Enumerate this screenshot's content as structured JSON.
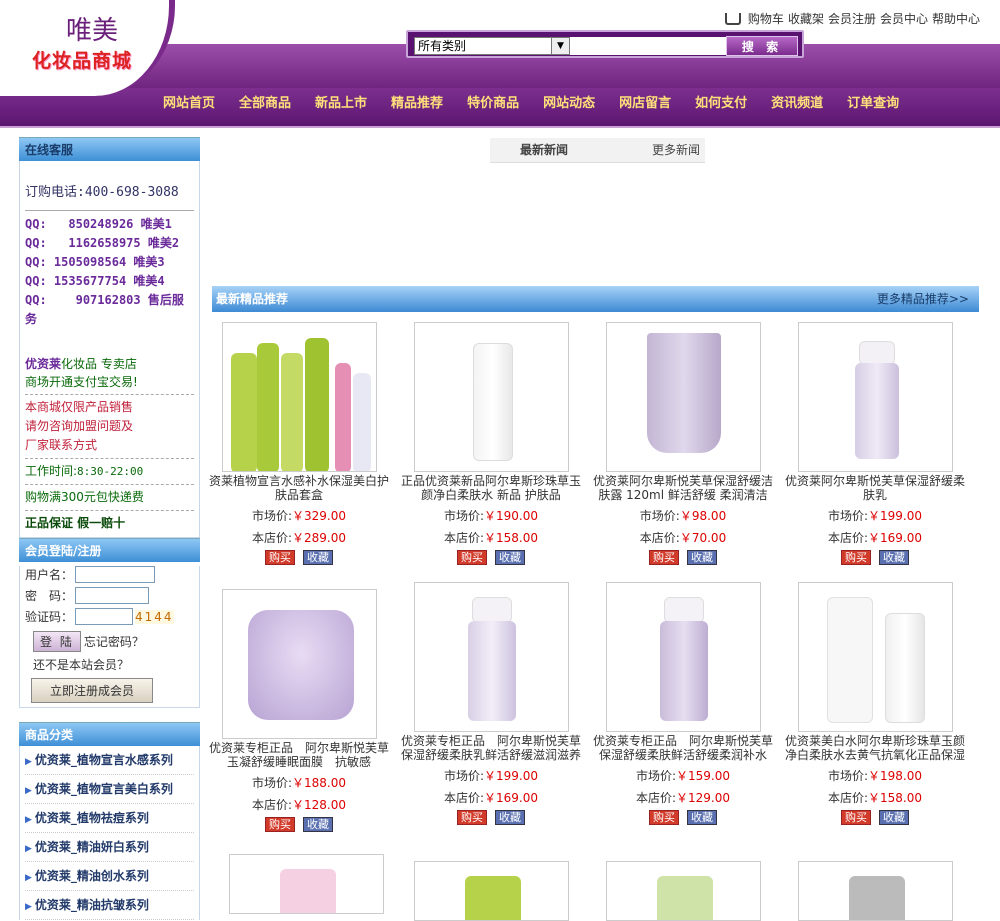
{
  "logo": {
    "line1": "唯美",
    "line2": "化妆品商城"
  },
  "toplinks": [
    "购物车",
    "收藏架",
    "会员注册",
    "会员中心",
    "帮助中心"
  ],
  "search": {
    "category": "所有类别",
    "button": "搜 索"
  },
  "nav": [
    "网站首页",
    "全部商品",
    "新品上市",
    "精品推荐",
    "特价商品",
    "网站动态",
    "网店留言",
    "如何支付",
    "资讯频道",
    "订单查询"
  ],
  "service": {
    "title": "在线客服",
    "phone": "订购电话:400-698-3088",
    "qq": [
      {
        "label": "QQ:",
        "num": "850248926",
        "name": "唯美1"
      },
      {
        "label": "QQ:",
        "num": "1162658975",
        "name": "唯美2"
      },
      {
        "label": "QQ:",
        "num": "1505098564",
        "name": "唯美3"
      },
      {
        "label": "QQ:",
        "num": "1535677754",
        "name": "唯美4"
      },
      {
        "label": "QQ:",
        "num": "907162803",
        "name": "售后服务"
      }
    ],
    "brand": "优资莱",
    "brand_rest": "化妆品 专卖店",
    "alipay": "商场开通支付宝交易!",
    "notice1": "本商城仅限产品销售",
    "notice2": "请勿咨询加盟问题及",
    "notice3": "厂家联系方式",
    "hours_label": "工作时间:",
    "hours": "8:30-22:00",
    "shipping": "购物满300元包快递费",
    "guarantee": "正品保证 假一赔十"
  },
  "login": {
    "title": "会员登陆/注册",
    "username": "用户名：",
    "password": "密　码：",
    "captcha": "验证码：",
    "code": "4144",
    "login_btn": "登 陆",
    "forgot": "忘记密码？",
    "not_member": "还不是本站会员？",
    "register_btn": "立即注册成会员"
  },
  "categories": {
    "title": "商品分类",
    "items": [
      "优资莱_植物宣言水感系列",
      "优资莱_植物宣言美白系列",
      "优资莱_植物祛痘系列",
      "优资莱_精油妍白系列",
      "优资莱_精油创水系列",
      "优资莱_精油抗皱系列"
    ]
  },
  "news": {
    "latest": "最新新闻",
    "more": "更多新闻"
  },
  "recommend": {
    "title": "最新精品推荐",
    "more": "更多精品推荐>>"
  },
  "labels": {
    "market": "市场价:",
    "store": "本店价:",
    "buy": "购买",
    "fav": "收藏"
  },
  "products": [
    {
      "name": "资莱植物宣言水感补水保湿美白护肤品套盒",
      "market": "￥329.00",
      "store": "￥289.00"
    },
    {
      "name": "正品优资莱新品阿尔卑斯珍珠草玉颜净白柔肤水 新品 护肤品",
      "market": "￥190.00",
      "store": "￥158.00"
    },
    {
      "name": "优资莱阿尔卑斯悦芙草保湿舒缓洁肤露 120ml 鲜活舒缓 柔润清洁",
      "market": "￥98.00",
      "store": "￥70.00"
    },
    {
      "name": "优资莱阿尔卑斯悦芙草保湿舒缓柔肤乳",
      "market": "￥199.00",
      "store": "￥169.00"
    },
    {
      "name": "优资莱专柜正品　阿尔卑斯悦芙草玉凝舒缓睡眠面膜　抗敏感",
      "market": "￥188.00",
      "store": "￥128.00"
    },
    {
      "name": "优资莱专柜正品　阿尔卑斯悦芙草保湿舒缓柔肤乳鲜活舒缓滋润滋养",
      "market": "￥199.00",
      "store": "￥169.00"
    },
    {
      "name": "优资莱专柜正品　阿尔卑斯悦芙草保湿舒缓柔肤鲜活舒缓柔润补水",
      "market": "￥159.00",
      "store": "￥129.00"
    },
    {
      "name": "优资莱美白水阿尔卑斯珍珠草玉颜净白柔肤水去黄气抗氧化正品保湿",
      "market": "￥198.00",
      "store": "￥158.00"
    }
  ],
  "colors": {
    "purple": "#6a1f7a",
    "nav_text": "#ffe07a",
    "blue_head": "#3d8fd6",
    "price": "#dd0000"
  }
}
